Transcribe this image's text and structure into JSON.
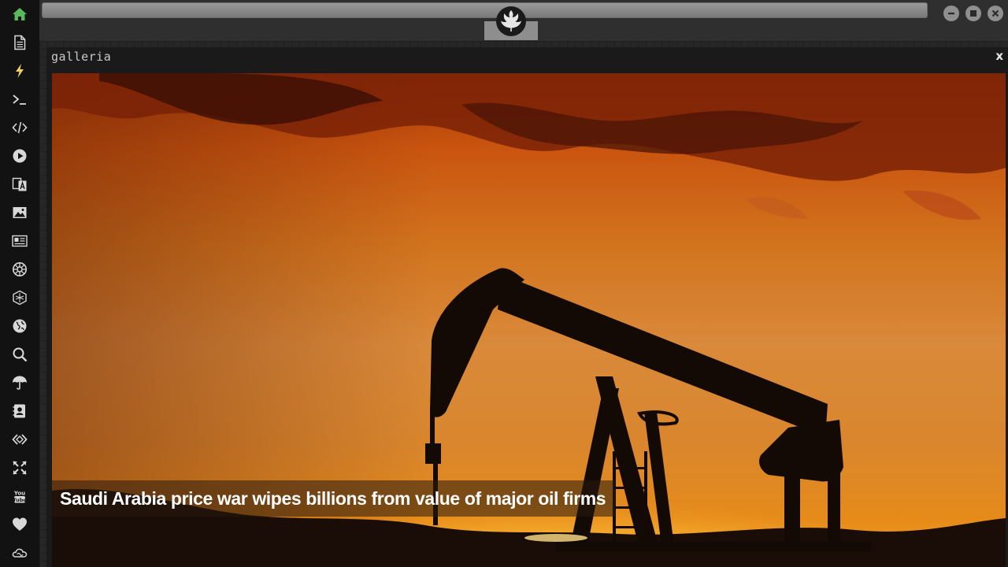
{
  "sidebar": {
    "items": [
      {
        "icon": "home-icon",
        "active": true
      },
      {
        "icon": "document-icon"
      },
      {
        "icon": "lightning-icon"
      },
      {
        "icon": "terminal-icon"
      },
      {
        "icon": "code-icon"
      },
      {
        "icon": "play-icon"
      },
      {
        "icon": "translate-icon"
      },
      {
        "icon": "image-icon"
      },
      {
        "icon": "newspaper-icon"
      },
      {
        "icon": "galactic-empire-icon"
      },
      {
        "icon": "hexagon-icon"
      },
      {
        "icon": "globe-icon"
      },
      {
        "icon": "search-icon"
      },
      {
        "icon": "umbrella-icon"
      },
      {
        "icon": "contacts-icon"
      },
      {
        "icon": "embed-icon"
      },
      {
        "icon": "fullscreen-icon"
      },
      {
        "icon": "youtube-icon"
      },
      {
        "icon": "heart-icon"
      },
      {
        "icon": "cloud-icon"
      }
    ],
    "active_color": "#5cb85c",
    "icon_color": "#d8d8d8"
  },
  "topbar": {
    "emblem_icon": "rebel-alliance-icon",
    "controls": [
      "minimize-icon",
      "maximize-icon",
      "close-icon"
    ]
  },
  "window": {
    "title": "galleria",
    "close_label": "x"
  },
  "gallery": {
    "image_subject": "oil-pumpjack-sunset",
    "caption": "Saudi Arabia price war wipes billions from value of major oil firms"
  }
}
